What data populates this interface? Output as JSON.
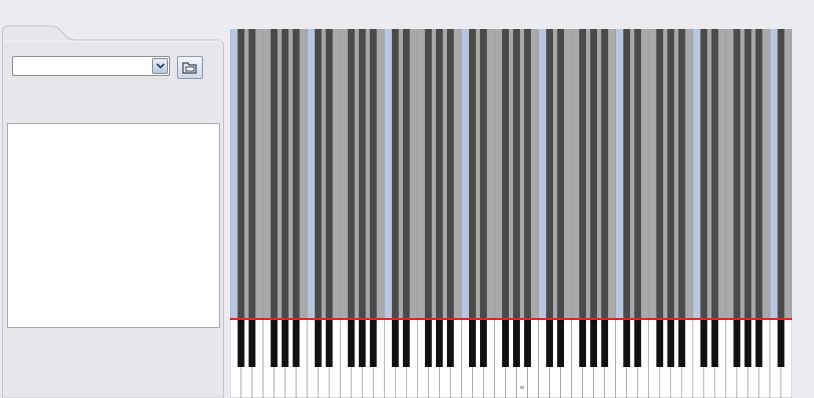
{
  "dropdown": {
    "value": ""
  },
  "icons": {
    "dropdown_arrow": "chevron-down-icon",
    "folder_button": "open-folder-icon"
  },
  "file_list": {
    "items": []
  },
  "piano_roll": {
    "octaves": 7,
    "colors": {
      "white_lane": "#a9a9aa",
      "white_lane_c": "#b8c6e0",
      "black_lane": "#4a4a4a",
      "playline": "#d62a2a",
      "white_key": "#ffffff",
      "black_key": "#111111",
      "key_border": "#8a8a8a"
    }
  }
}
